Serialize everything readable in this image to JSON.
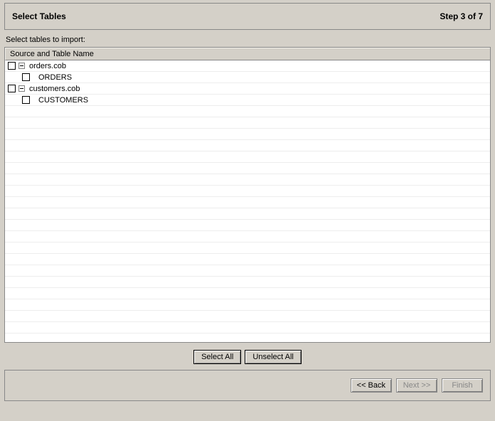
{
  "header": {
    "title": "Select Tables",
    "step": "Step 3 of 7"
  },
  "instruction": "Select tables to import:",
  "columnHeader": "Source and Table Name",
  "tree": {
    "items": [
      {
        "label": "orders.cob",
        "indent": 0,
        "expander": true,
        "checkbox": true
      },
      {
        "label": "ORDERS",
        "indent": 1,
        "expander": false,
        "checkbox": true
      },
      {
        "label": "customers.cob",
        "indent": 0,
        "expander": true,
        "checkbox": true
      },
      {
        "label": "CUSTOMERS",
        "indent": 1,
        "expander": false,
        "checkbox": true
      }
    ]
  },
  "buttons": {
    "selectAll": "Select All",
    "unselectAll": "Unselect All",
    "back": "<< Back",
    "next": "Next >>",
    "finish": "Finish"
  }
}
